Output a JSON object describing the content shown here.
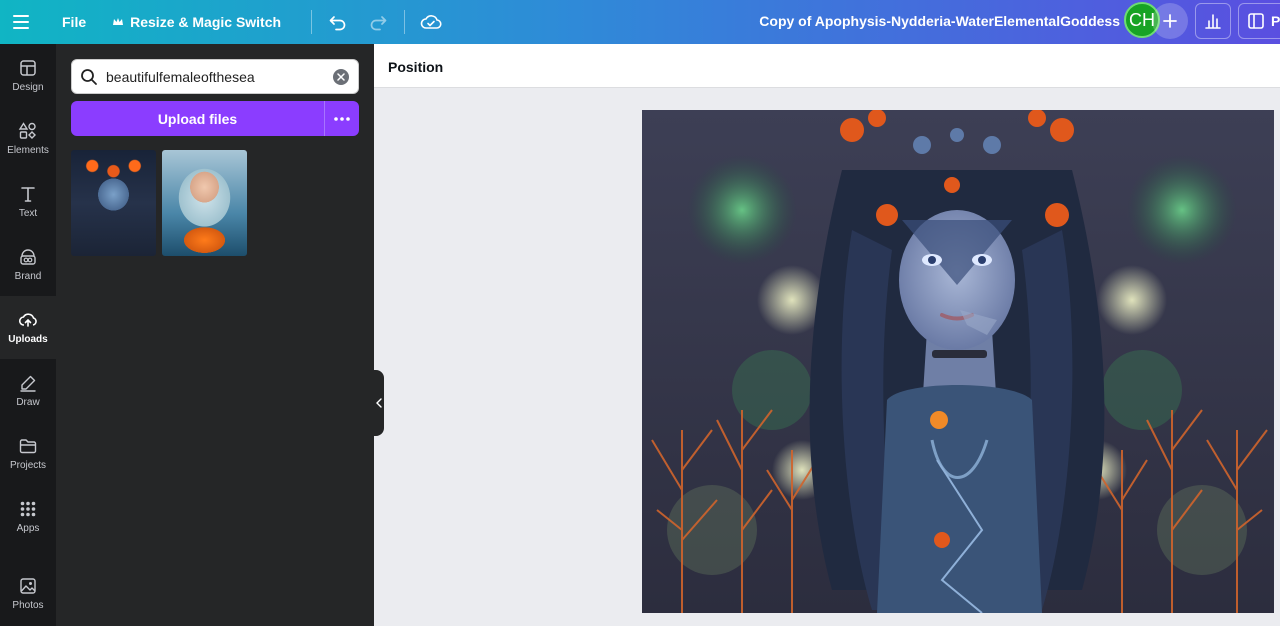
{
  "topbar": {
    "file_label": "File",
    "resize_label": "Resize & Magic Switch",
    "doc_title": "Copy of Apophysis-Nydderia-WaterElementalGoddess",
    "avatar_initials": "CH",
    "present_label": "P"
  },
  "rail": {
    "items": [
      {
        "label": "Design"
      },
      {
        "label": "Elements"
      },
      {
        "label": "Text"
      },
      {
        "label": "Brand"
      },
      {
        "label": "Uploads"
      },
      {
        "label": "Draw"
      },
      {
        "label": "Projects"
      },
      {
        "label": "Apps"
      },
      {
        "label": "Photos"
      }
    ]
  },
  "panel": {
    "search_value": "beautifulfemaleofthesea",
    "upload_label": "Upload files"
  },
  "ctx": {
    "position_label": "Position"
  },
  "colors": {
    "accent": "#8b3dff",
    "avatar": "#17a324"
  }
}
